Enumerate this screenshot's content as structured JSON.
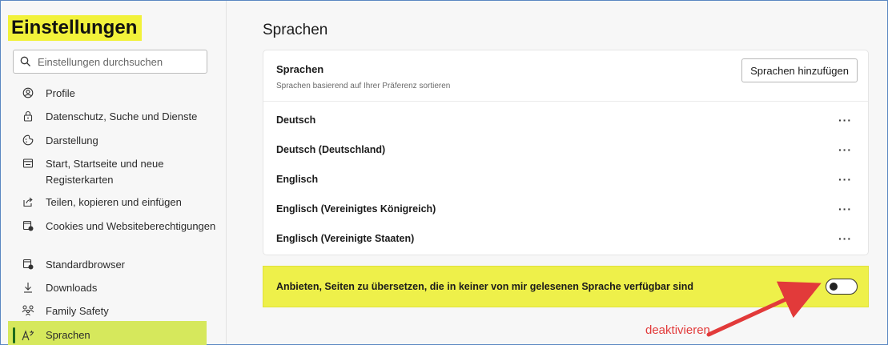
{
  "sidebar": {
    "title": "Einstellungen",
    "search_placeholder": "Einstellungen durchsuchen",
    "items": [
      {
        "label": "Profile",
        "icon": "profile-icon"
      },
      {
        "label": "Datenschutz, Suche und Dienste",
        "icon": "lock-icon"
      },
      {
        "label": "Darstellung",
        "icon": "appearance-icon"
      },
      {
        "label": "Start, Startseite und neue Registerkarten",
        "icon": "home-tabs-icon"
      },
      {
        "label": "Teilen, kopieren und einfügen",
        "icon": "share-icon"
      },
      {
        "label": "Cookies und Websiteberechtigungen",
        "icon": "cookies-icon"
      },
      {
        "label": "Standardbrowser",
        "icon": "browser-icon"
      },
      {
        "label": "Downloads",
        "icon": "download-icon"
      },
      {
        "label": "Family Safety",
        "icon": "family-icon"
      },
      {
        "label": "Sprachen",
        "icon": "languages-icon",
        "active": true
      }
    ]
  },
  "main": {
    "title": "Sprachen",
    "card": {
      "title": "Sprachen",
      "subtitle": "Sprachen basierend auf Ihrer Präferenz sortieren",
      "add_button": "Sprachen hinzufügen",
      "languages": [
        "Deutsch",
        "Deutsch (Deutschland)",
        "Englisch",
        "Englisch (Vereinigtes Königreich)",
        "Englisch (Vereinigte Staaten)"
      ],
      "more_label": "···"
    },
    "offer_translate": {
      "label": "Anbieten, Seiten zu übersetzen, die in keiner von mir gelesenen Sprache verfügbar sind",
      "enabled": false
    }
  },
  "annotation": {
    "label": "deaktivieren",
    "color": "#e23a3a"
  },
  "colors": {
    "highlight": "#eef04a",
    "active_bar": "#1c6b1c"
  }
}
